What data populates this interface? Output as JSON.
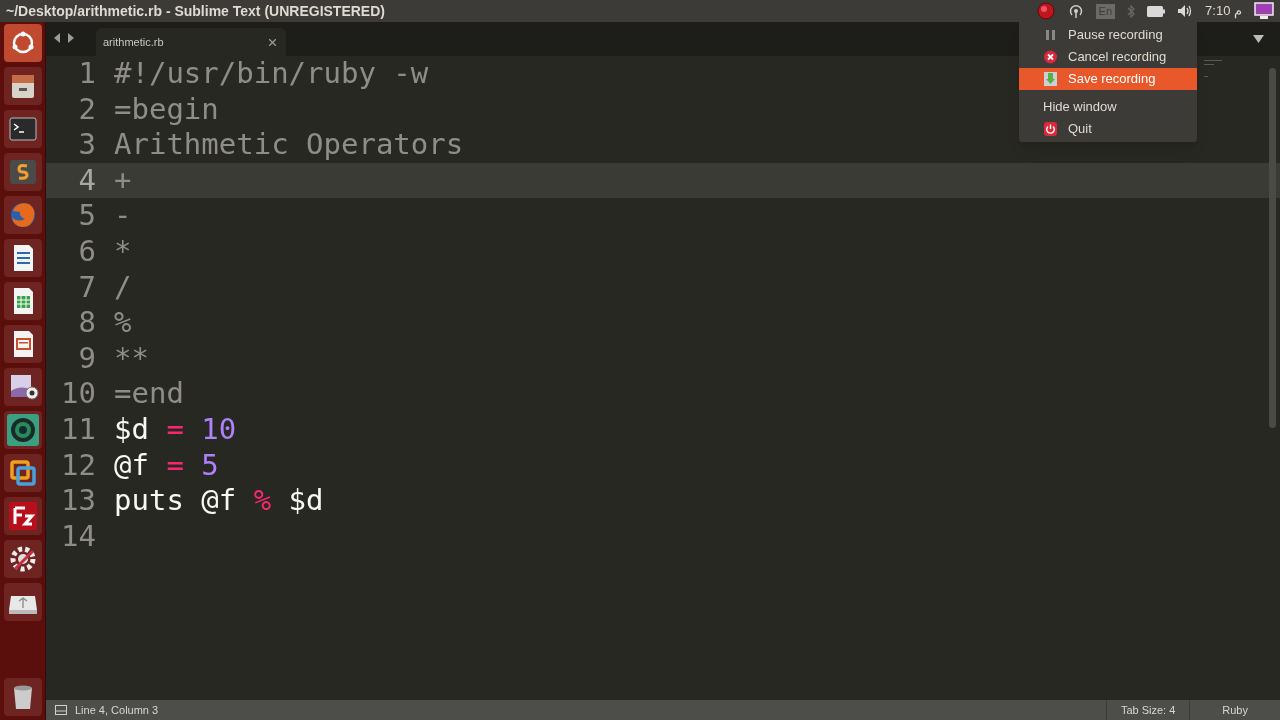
{
  "window": {
    "title": "~/Desktop/arithmetic.rb - Sublime Text (UNREGISTERED)"
  },
  "tray": {
    "keyboard": "En",
    "clock": "م 7:10"
  },
  "launcher": {
    "items": [
      {
        "kind": "dash"
      },
      {
        "kind": "files"
      },
      {
        "kind": "terminal"
      },
      {
        "kind": "sublime"
      },
      {
        "kind": "firefox"
      },
      {
        "kind": "writer"
      },
      {
        "kind": "calc"
      },
      {
        "kind": "impress"
      },
      {
        "kind": "webcam"
      },
      {
        "kind": "globe"
      },
      {
        "kind": "vmware"
      },
      {
        "kind": "filezilla"
      },
      {
        "kind": "settings"
      },
      {
        "kind": "usb"
      },
      {
        "kind": "trash"
      }
    ]
  },
  "tabs": [
    {
      "label": "arithmetic.rb",
      "selected": true
    }
  ],
  "editor": {
    "lines": [
      {
        "number": "1",
        "tokens": [
          {
            "kind": "comment",
            "text": "#!/usr/bin/ruby -w"
          }
        ]
      },
      {
        "number": "2",
        "tokens": [
          {
            "kind": "comment",
            "text": "=begin"
          }
        ]
      },
      {
        "number": "3",
        "tokens": [
          {
            "kind": "comment",
            "text": "Arithmetic Operators"
          }
        ]
      },
      {
        "number": "4",
        "current": true,
        "tokens": [
          {
            "kind": "comment",
            "text": "+"
          }
        ]
      },
      {
        "number": "5",
        "tokens": [
          {
            "kind": "comment",
            "text": "-"
          }
        ]
      },
      {
        "number": "6",
        "tokens": [
          {
            "kind": "comment",
            "text": "*"
          }
        ]
      },
      {
        "number": "7",
        "tokens": [
          {
            "kind": "comment",
            "text": "/"
          }
        ]
      },
      {
        "number": "8",
        "tokens": [
          {
            "kind": "comment",
            "text": "%"
          }
        ]
      },
      {
        "number": "9",
        "tokens": [
          {
            "kind": "comment",
            "text": "**"
          }
        ]
      },
      {
        "number": "10",
        "tokens": [
          {
            "kind": "comment",
            "text": "=end"
          }
        ]
      },
      {
        "number": "11",
        "tokens": [
          {
            "kind": "plain",
            "text": "$d "
          },
          {
            "kind": "operator",
            "text": "="
          },
          {
            "kind": "number",
            "text": " 10"
          }
        ]
      },
      {
        "number": "12",
        "tokens": [
          {
            "kind": "plain",
            "text": "@f "
          },
          {
            "kind": "operator",
            "text": "="
          },
          {
            "kind": "number",
            "text": " 5"
          }
        ]
      },
      {
        "number": "13",
        "tokens": [
          {
            "kind": "plain",
            "text": "puts @f "
          },
          {
            "kind": "operator",
            "text": "%"
          },
          {
            "kind": "plain",
            "text": " $d"
          }
        ]
      },
      {
        "number": "14"
      }
    ]
  },
  "recorder_menu": {
    "items": [
      {
        "kind": "pause",
        "label": "Pause recording",
        "selected": false
      },
      {
        "kind": "cancel",
        "label": "Cancel recording",
        "selected": false
      },
      {
        "kind": "save",
        "label": "Save recording",
        "selected": true
      },
      {
        "kind": "plain",
        "label": "Hide window",
        "selected": false
      },
      {
        "kind": "quit",
        "label": "Quit",
        "selected": false
      }
    ]
  },
  "status_bar": {
    "position": "Line 4, Column 3",
    "tab_size": "Tab Size: 4",
    "syntax": "Ruby"
  }
}
